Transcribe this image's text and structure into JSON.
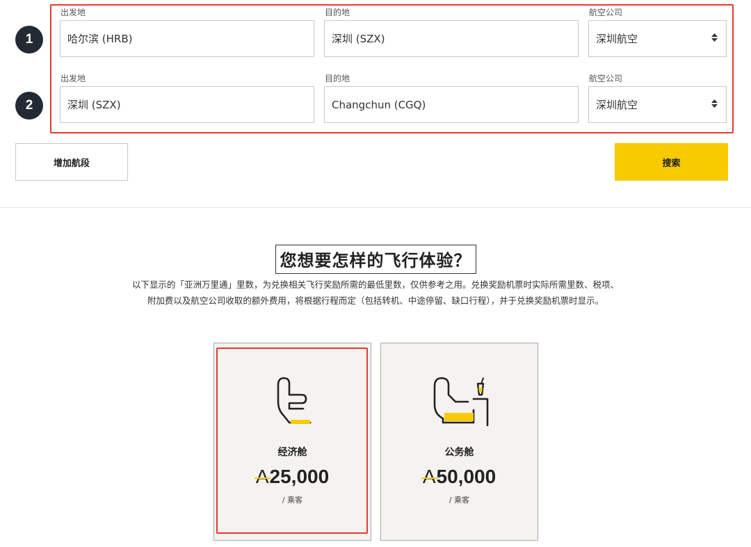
{
  "legs": [
    {
      "number": "1",
      "origin_label": "出发地",
      "origin_value": "哈尔滨 (HRB)",
      "destination_label": "目的地",
      "destination_value": "深圳 (SZX)",
      "airline_label": "航空公司",
      "airline_value": "深圳航空"
    },
    {
      "number": "2",
      "origin_label": "出发地",
      "origin_value": "深圳 (SZX)",
      "destination_label": "目的地",
      "destination_value": "Changchun (CGQ)",
      "airline_label": "航空公司",
      "airline_value": "深圳航空"
    }
  ],
  "actions": {
    "add_leg_label": "增加航段",
    "search_label": "搜索"
  },
  "experience": {
    "headline": "您想要怎样的飞行体验？",
    "description_line1": "以下显示的「亚洲万里通」里数，为兑换相关飞行奖励所需的最低里数，仅供参考之用。兑换奖励机票时实际所需里数、税项、",
    "description_line2": "附加费以及航空公司收取的额外费用，将根据行程而定（包括转机、中途停留、缺口行程），并于兑换奖励机票时显示。"
  },
  "cabins": [
    {
      "name": "经济舱",
      "miles_symbol": "A",
      "miles": "25,000",
      "per": "/ 乘客",
      "icon": "economy-seat-icon"
    },
    {
      "name": "公务舱",
      "miles_symbol": "A",
      "miles": "50,000",
      "per": "/ 乘客",
      "icon": "business-seat-icon"
    }
  ],
  "colors": {
    "accent": "#f7cb00",
    "highlight": "#e53935",
    "badge": "#222a33"
  }
}
